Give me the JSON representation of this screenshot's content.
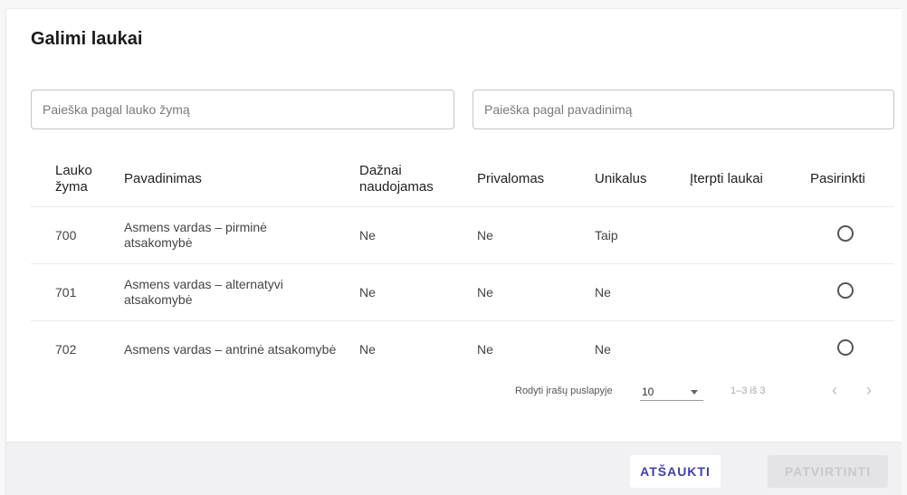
{
  "dialog": {
    "title": "Galimi laukai",
    "search_tag_placeholder": "Paieška pagal lauko žymą",
    "search_name_placeholder": "Paieška pagal pavadinimą"
  },
  "table": {
    "headers": [
      "Lauko žyma",
      "Pavadinimas",
      "Dažnai naudojamas",
      "Privalomas",
      "Unikalus",
      "Įterpti laukai",
      "Pasirinkti"
    ],
    "rows": [
      {
        "tag": "700",
        "name": "Asmens vardas – pirminė atsakomybė",
        "frequent": "Ne",
        "required": "Ne",
        "unique": "Taip",
        "inserted": ""
      },
      {
        "tag": "701",
        "name": "Asmens vardas – alternatyvi atsakomybė",
        "frequent": "Ne",
        "required": "Ne",
        "unique": "Ne",
        "inserted": ""
      },
      {
        "tag": "702",
        "name": "Asmens vardas – antrinė atsakomybė",
        "frequent": "Ne",
        "required": "Ne",
        "unique": "Ne",
        "inserted": ""
      }
    ]
  },
  "pager": {
    "rows_per_page_label": "Rodyti įrašų puslapyje",
    "rows_per_page_value": "10",
    "range": "1–3 iš 3",
    "prev_glyph": "‹",
    "next_glyph": "›"
  },
  "footer": {
    "cancel_label": "ATŠAUKTI",
    "confirm_label": "PATVIRTINTI"
  }
}
